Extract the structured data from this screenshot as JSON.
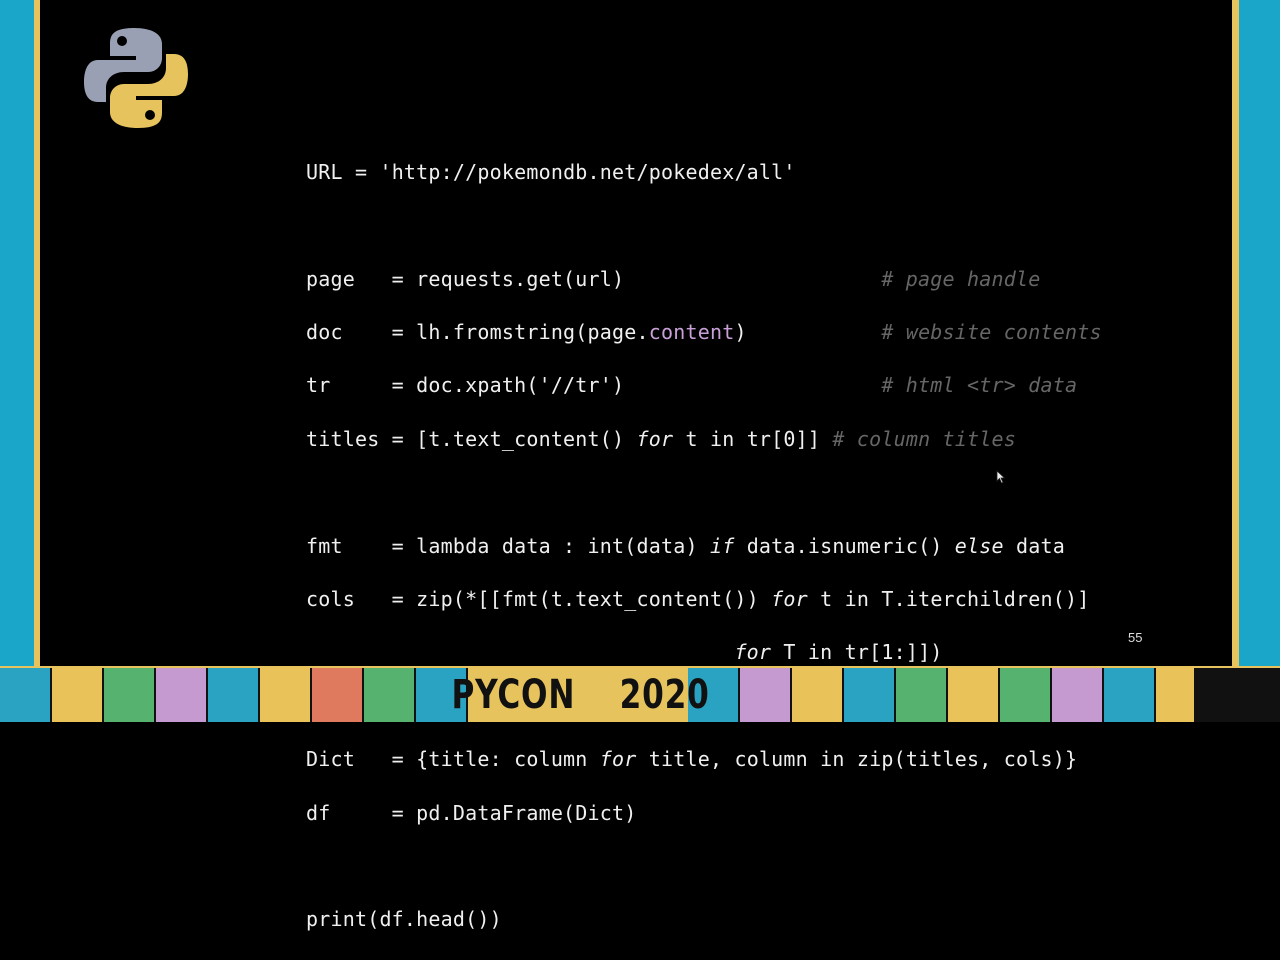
{
  "slide": {
    "page_number": "55",
    "code_lines": [
      "URL = 'http://pokemondb.net/pokedex/all'",
      "",
      "page   = requests.get(url)                     # page handle",
      "doc    = lh.fromstring(page.content)           # website contents",
      "tr     = doc.xpath('//tr')                     # html <tr> data",
      "titles = [t.text_content() for t in tr[0]] # column titles",
      "",
      "fmt    = lambda data : int(data) if data.isnumeric() else data",
      "cols   = zip(*[[fmt(t.text_content()) for t in T.iterchildren()]",
      "                                   for T in tr[1:]])",
      "",
      "Dict   = {title: column for title, column in zip(titles, cols)}",
      "df     = pd.DataFrame(Dict)",
      "",
      "print(df.head())"
    ]
  },
  "banner": {
    "event_word": "PYCON",
    "event_year": "2020",
    "colors": {
      "frame_blue": "#1aa6c8",
      "frame_gold": "#e7c35e",
      "tile_colors": [
        "#2aa3c2",
        "#e9c25a",
        "#c49ad1",
        "#56b36f",
        "#e07a5f"
      ]
    }
  },
  "icons": {
    "logo": "python-logo-icon",
    "cursor": "mouse-pointer-icon"
  }
}
